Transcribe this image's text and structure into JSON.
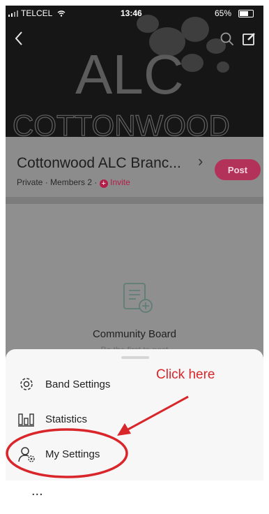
{
  "status_bar": {
    "carrier": "TELCEL",
    "time": "13:46",
    "battery": "65%"
  },
  "cover": {
    "logo_text": "ALC",
    "wordmark": "COTTONWOOD"
  },
  "header": {
    "band_name": "Cottonwood ALC Branc...",
    "privacy": "Private",
    "members": "Members 2",
    "invite": "Invite",
    "post_label": "Post"
  },
  "board": {
    "title": "Community Board",
    "subtitle": "Be the first to post"
  },
  "sheet": {
    "items": [
      {
        "label": "Band Settings",
        "icon": "gear-icon"
      },
      {
        "label": "Statistics",
        "icon": "stats-icon"
      },
      {
        "label": "My Settings",
        "icon": "user-settings-icon"
      }
    ]
  },
  "annotation": {
    "text": "Click here",
    "color": "#d9262b"
  },
  "footer": {
    "ellipsis": "..."
  },
  "colors": {
    "accent": "#b3325a",
    "overlay": "#8e8e8e",
    "sheet": "#f7f7f7"
  }
}
